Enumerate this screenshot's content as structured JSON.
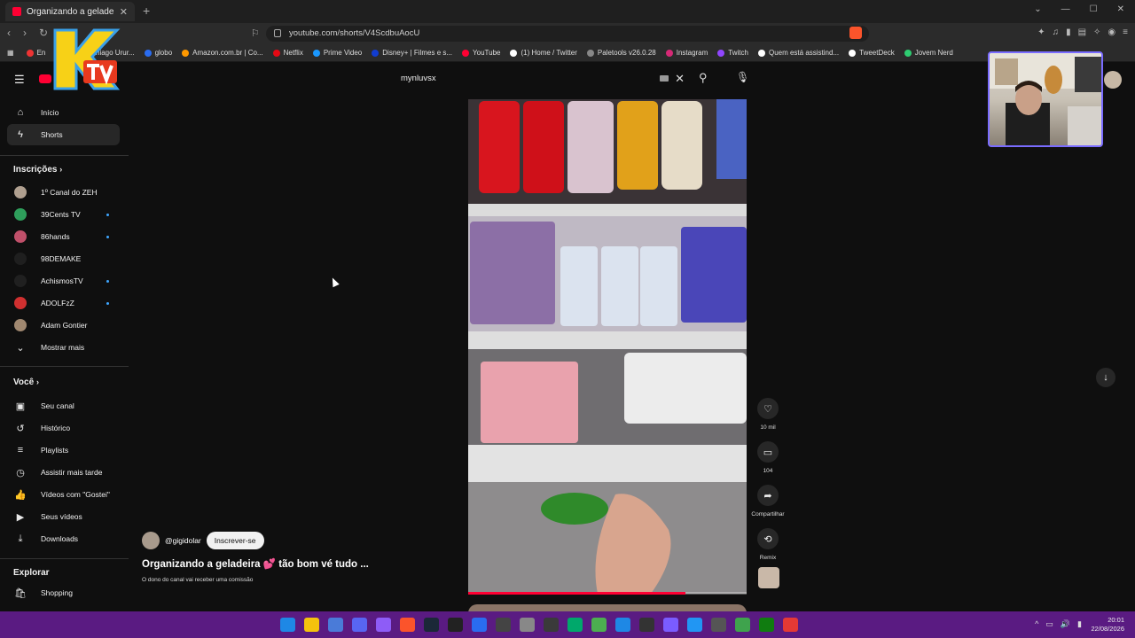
{
  "browser": {
    "tab_title": "Organizando a geladeira",
    "url": "youtube.com/shorts/V4ScdbuAocU",
    "bookmarks": [
      {
        "label": "En",
        "color": "#e33"
      },
      {
        "label": "Email – Thiago Urur...",
        "color": "#2a6cf0"
      },
      {
        "label": "globo",
        "color": "#2a6cf0"
      },
      {
        "label": "Amazon.com.br | Co...",
        "color": "#ff9900"
      },
      {
        "label": "Netflix",
        "color": "#e50914"
      },
      {
        "label": "Prime Video",
        "color": "#1a98ff"
      },
      {
        "label": "Disney+ | Filmes e s...",
        "color": "#113ccf"
      },
      {
        "label": "YouTube",
        "color": "#ff0033"
      },
      {
        "label": "(1) Home / Twitter",
        "color": "#ffffff"
      },
      {
        "label": "Paletools v26.0.28",
        "color": "#888888"
      },
      {
        "label": "Instagram",
        "color": "#d62976"
      },
      {
        "label": "Twitch",
        "color": "#9146ff"
      },
      {
        "label": "Quem está assistind...",
        "color": "#ffffff"
      },
      {
        "label": "TweetDeck",
        "color": "#ffffff"
      },
      {
        "label": "Jovem Nerd",
        "color": "#2ecc71"
      }
    ]
  },
  "youtube": {
    "search_value": "mynluvsx",
    "sidebar": {
      "home": "Início",
      "shorts": "Shorts",
      "subscriptions_heading": "Inscrições",
      "subscriptions": [
        {
          "label": "1º Canal do ZEH",
          "color": "#b0a090",
          "new": false
        },
        {
          "label": "39Cents TV",
          "color": "#2e9e5b",
          "new": true
        },
        {
          "label": "86hands",
          "color": "#c0506a",
          "new": true
        },
        {
          "label": "98DEMAKE",
          "color": "#1f1f1f",
          "new": false
        },
        {
          "label": "AchismosTV",
          "color": "#202020",
          "new": true
        },
        {
          "label": "ADOLFzZ",
          "color": "#d03030",
          "new": true
        },
        {
          "label": "Adam Gontier",
          "color": "#a08870",
          "new": false
        }
      ],
      "show_more": "Mostrar mais",
      "you_heading": "Você",
      "you_items": [
        {
          "label": "Seu canal",
          "icon": "user-square-icon",
          "glyph": "▣"
        },
        {
          "label": "Histórico",
          "icon": "history-icon",
          "glyph": "↺"
        },
        {
          "label": "Playlists",
          "icon": "playlist-icon",
          "glyph": "≡"
        },
        {
          "label": "Assistir mais tarde",
          "icon": "clock-icon",
          "glyph": "◷"
        },
        {
          "label": "Vídeos com \"Gostei\"",
          "icon": "thumbs-up-icon",
          "glyph": "👍"
        },
        {
          "label": "Seus vídeos",
          "icon": "video-icon",
          "glyph": "▶"
        },
        {
          "label": "Downloads",
          "icon": "download-icon",
          "glyph": "⤓"
        }
      ],
      "explore_heading": "Explorar",
      "explore_items": [
        {
          "label": "Shopping",
          "icon": "shopping-bag-icon",
          "glyph": "🛍"
        }
      ]
    },
    "short": {
      "channel": "@gigidolar",
      "subscribe_label": "Inscrever-se",
      "title": "Organizando a geladeira 💕 tão bom vé tudo ...",
      "note": "O dono do canal vai receber uma comissão",
      "likes": "10 mil",
      "comments": "104",
      "share_label": "Compartilhar",
      "remix_label": "Remix",
      "progress": 0.78
    }
  },
  "taskbar": {
    "time": "20:01",
    "date": "22/08/2026",
    "icon_colors": [
      "#1e88e5",
      "#f4c20d",
      "#4a7bd8",
      "#5865f2",
      "#8e5cf7",
      "#fb542b",
      "#1b2838",
      "#222222",
      "#2a6cf0",
      "#444444",
      "#888888",
      "#3a3a3a",
      "#00a86b",
      "#4caf50",
      "#1e88e5",
      "#333333",
      "#7a5cff",
      "#2196f3",
      "#555555",
      "#3fa34d",
      "#107c10",
      "#e53935",
      "#5a1b82"
    ]
  }
}
